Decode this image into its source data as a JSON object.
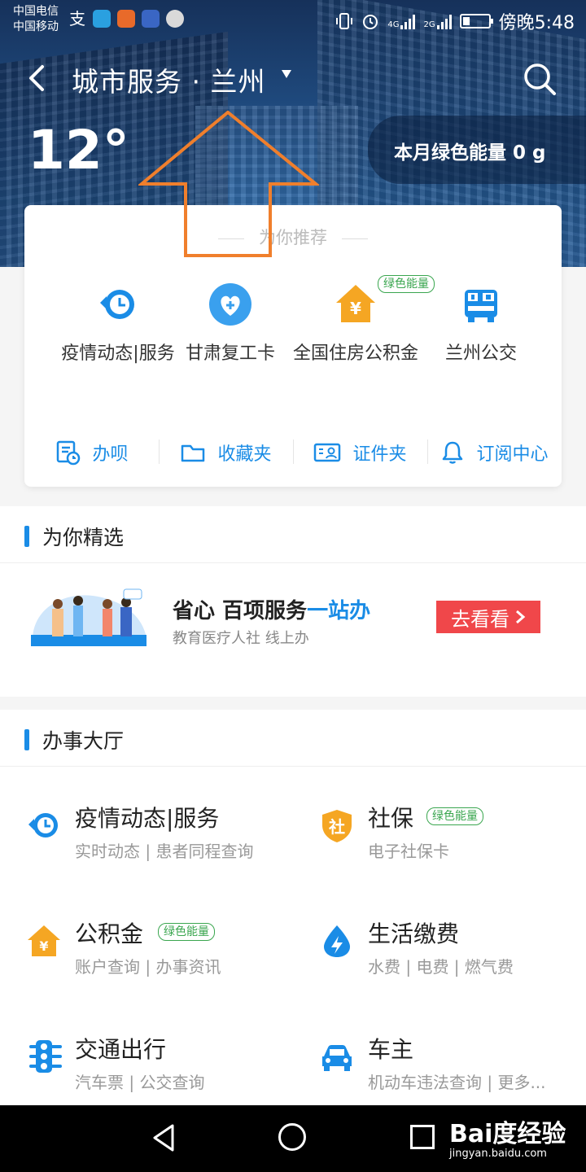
{
  "status": {
    "carrier1": "中国电信",
    "carrier2": "中国移动",
    "time": "傍晚5:48",
    "net1": "4G",
    "net2": "2G"
  },
  "header": {
    "title": "城市服务 · 兰州",
    "temperature": "12°",
    "energy": "本月绿色能量 0 g"
  },
  "recommend": {
    "title": "为你推荐",
    "items": [
      {
        "label": "疫情动态|服务",
        "icon": "epidemic-clock-icon"
      },
      {
        "label": "甘肃复工卡",
        "icon": "heart-plus-icon"
      },
      {
        "label": "全国住房公积金",
        "icon": "house-yuan-icon",
        "badge": "绿色能量"
      },
      {
        "label": "兰州公交",
        "icon": "bus-qr-icon"
      }
    ],
    "quick": [
      {
        "label": "办呗",
        "icon": "doc-clock-icon"
      },
      {
        "label": "收藏夹",
        "icon": "folder-icon"
      },
      {
        "label": "证件夹",
        "icon": "id-card-icon"
      },
      {
        "label": "订阅中心",
        "icon": "bell-icon"
      }
    ]
  },
  "featured": {
    "title": "为你精选",
    "promo_title_a": "省心 百项服务",
    "promo_title_b": "一站办",
    "promo_sub": "教育医疗人社 线上办",
    "promo_btn": "去看看"
  },
  "hall": {
    "title": "办事大厅",
    "items": [
      {
        "title": "疫情动态|服务",
        "sub": "实时动态 | 患者同程查询",
        "icon": "epidemic-clock-icon"
      },
      {
        "title": "社保",
        "sub": "电子社保卡",
        "badge": "绿色能量",
        "icon": "shield-she-icon"
      },
      {
        "title": "公积金",
        "sub": "账户查询 | 办事资讯",
        "badge": "绿色能量",
        "icon": "house-yuan-icon"
      },
      {
        "title": "生活缴费",
        "sub": "水费 | 电费 | 燃气费",
        "icon": "water-bolt-icon"
      },
      {
        "title": "交通出行",
        "sub": "汽车票 | 公交查询",
        "icon": "traffic-light-icon"
      },
      {
        "title": "车主",
        "sub": "机动车违法查询 | 更多...",
        "icon": "car-icon"
      }
    ]
  },
  "watermark": {
    "logo": "Bai度经验",
    "url": "jingyan.baidu.com"
  },
  "colors": {
    "accent": "#1a8ce6",
    "orange": "#f5a623",
    "green_badge": "#3aa64f",
    "cta": "#f0474a",
    "arrow": "#f07f2c"
  }
}
